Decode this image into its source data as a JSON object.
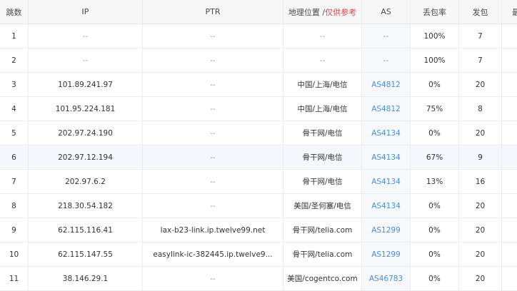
{
  "headers": {
    "hop": "跳数",
    "ip": "IP",
    "ptr": "PTR",
    "geo_main": "地理位置 / ",
    "geo_note": "仅供参考",
    "as": "AS",
    "loss": "丢包率",
    "sent": "发包",
    "best": "最"
  },
  "rows": [
    {
      "hop": "1",
      "ip": "--",
      "ptr": "--",
      "geo": "--",
      "as": "--",
      "loss": "100%",
      "sent": "7"
    },
    {
      "hop": "2",
      "ip": "--",
      "ptr": "--",
      "geo": "--",
      "as": "--",
      "loss": "100%",
      "sent": "7"
    },
    {
      "hop": "3",
      "ip": "101.89.241.97",
      "ptr": "--",
      "geo": "中国/上海/电信",
      "as": "AS4812",
      "loss": "0%",
      "sent": "20"
    },
    {
      "hop": "4",
      "ip": "101.95.224.181",
      "ptr": "--",
      "geo": "中国/上海/电信",
      "as": "AS4812",
      "loss": "75%",
      "sent": "8"
    },
    {
      "hop": "5",
      "ip": "202.97.24.190",
      "ptr": "--",
      "geo": "骨干网/电信",
      "as": "AS4134",
      "loss": "0%",
      "sent": "20"
    },
    {
      "hop": "6",
      "ip": "202.97.12.194",
      "ptr": "--",
      "geo": "骨干网/电信",
      "as": "AS4134",
      "loss": "67%",
      "sent": "9"
    },
    {
      "hop": "7",
      "ip": "202.97.6.2",
      "ptr": "--",
      "geo": "骨干网/电信",
      "as": "AS4134",
      "loss": "13%",
      "sent": "16"
    },
    {
      "hop": "8",
      "ip": "218.30.54.182",
      "ptr": "--",
      "geo": "美国/圣何塞/电信",
      "as": "AS4134",
      "loss": "0%",
      "sent": "20"
    },
    {
      "hop": "9",
      "ip": "62.115.116.41",
      "ptr": "lax-b23-link.ip.twelve99.net",
      "geo": "骨干网/telia.com",
      "as": "AS1299",
      "loss": "0%",
      "sent": "20"
    },
    {
      "hop": "10",
      "ip": "62.115.147.55",
      "ptr": "easylink-ic-382445.ip.twelve9...",
      "geo": "骨干网/telia.com",
      "as": "AS1299",
      "loss": "0%",
      "sent": "20"
    },
    {
      "hop": "11",
      "ip": "38.146.29.1",
      "ptr": "--",
      "geo": "美国/cogentco.com",
      "as": "AS46783",
      "loss": "0%",
      "sent": "20"
    }
  ],
  "colors": {
    "as_link": "#4a8ed8",
    "geo_note": "#e04848",
    "header_bg": "#f7f7f7",
    "hover_row_bg": "#f5f7fc"
  }
}
